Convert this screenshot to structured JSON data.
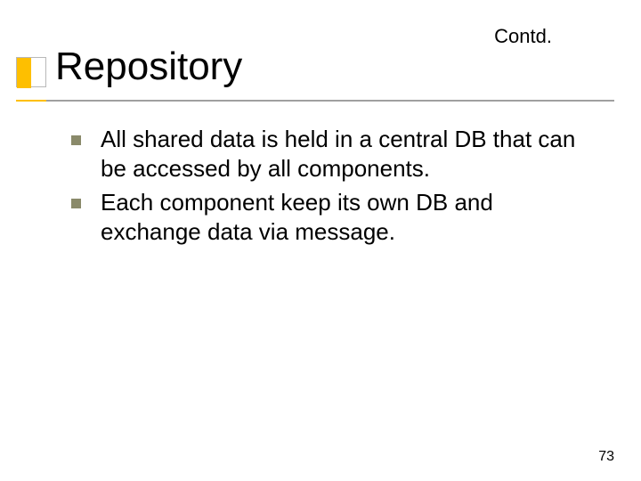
{
  "header": {
    "contd": "Contd.",
    "title": "Repository"
  },
  "bullets": [
    {
      "text": "All shared data is held in a central DB that can be accessed by all components."
    },
    {
      "text": "Each component keep its own DB and exchange data via message."
    }
  ],
  "footer": {
    "page_number": "73"
  }
}
